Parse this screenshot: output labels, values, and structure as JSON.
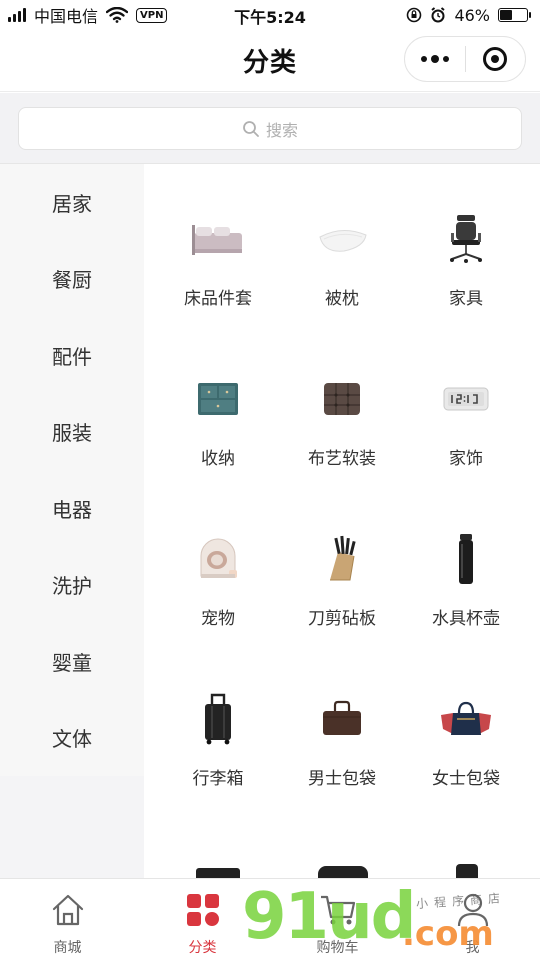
{
  "status_bar": {
    "carrier": "中国电信",
    "vpn": "VPN",
    "time": "下午5:24",
    "battery": "46%",
    "battery_level": 0.46
  },
  "nav": {
    "title": "分类"
  },
  "search": {
    "placeholder": "搜索"
  },
  "sidebar": {
    "items": [
      {
        "label": "居家"
      },
      {
        "label": "餐厨"
      },
      {
        "label": "配件"
      },
      {
        "label": "服装"
      },
      {
        "label": "电器"
      },
      {
        "label": "洗护"
      },
      {
        "label": "婴童"
      },
      {
        "label": "文体"
      }
    ]
  },
  "categories": [
    {
      "label": "床品件套",
      "icon": "bedding-icon"
    },
    {
      "label": "被枕",
      "icon": "pillow-icon"
    },
    {
      "label": "家具",
      "icon": "chair-icon"
    },
    {
      "label": "收纳",
      "icon": "storage-drawer-icon"
    },
    {
      "label": "布艺软装",
      "icon": "cushion-icon"
    },
    {
      "label": "家饰",
      "icon": "digital-clock-icon"
    },
    {
      "label": "宠物",
      "icon": "pet-litter-box-icon"
    },
    {
      "label": "刀剪砧板",
      "icon": "knife-block-icon"
    },
    {
      "label": "水具杯壶",
      "icon": "thermos-icon"
    },
    {
      "label": "行李箱",
      "icon": "suitcase-icon"
    },
    {
      "label": "男士包袋",
      "icon": "mens-bag-icon"
    },
    {
      "label": "女士包袋",
      "icon": "womens-bag-icon"
    }
  ],
  "tab_bar": {
    "tabs": [
      {
        "label": "商城",
        "icon": "home-icon"
      },
      {
        "label": "分类",
        "icon": "category-icon"
      },
      {
        "label": "购物车",
        "icon": "cart-icon"
      },
      {
        "label": "我",
        "icon": "user-icon"
      }
    ],
    "active_index": 1
  },
  "watermark": {
    "logo": "91ud",
    "domain": ".com",
    "tagline": "小程序商店"
  },
  "colors": {
    "accent": "#d9363e",
    "sidebar_bg": "#f7f7f7",
    "search_bg": "#f2f2f4"
  }
}
